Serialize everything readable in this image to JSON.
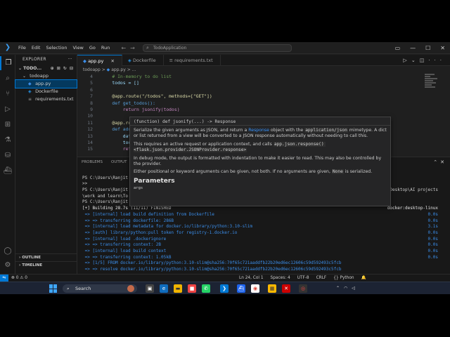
{
  "titlebar": {
    "menu": [
      "File",
      "Edit",
      "Selection",
      "View",
      "Go",
      "Run"
    ],
    "search": "TodoApplication"
  },
  "sidebar": {
    "header": "EXPLORER",
    "root": "TODO...",
    "folder": "todoapp",
    "files": [
      {
        "name": "app.py",
        "icon": "py"
      },
      {
        "name": "Dockerfile",
        "icon": "docker"
      },
      {
        "name": "requirements.txt",
        "icon": "txt"
      }
    ],
    "outline": "OUTLINE",
    "timeline": "TIMELINE"
  },
  "tabs": [
    {
      "label": "app.py",
      "active": true
    },
    {
      "label": "Dockerfile",
      "active": false
    },
    {
      "label": "requirements.txt",
      "active": false
    }
  ],
  "breadcrumb": {
    "folder": "todoapp",
    "sep": ">",
    "file": "app.py",
    "more": "> ..."
  },
  "code": [
    {
      "n": "4",
      "t": "    # In-memory to do list"
    },
    {
      "n": "5",
      "t": "    todos = []"
    },
    {
      "n": "6",
      "t": ""
    },
    {
      "n": "7",
      "t": "    @app.route(\"/todos\", methods=[\"GET\"])"
    },
    {
      "n": "8",
      "t": "    def get_todos():"
    },
    {
      "n": "9",
      "t": "        return jsonify(todos)"
    },
    {
      "n": "10",
      "t": ""
    },
    {
      "n": "11",
      "t": "    @app.route("
    },
    {
      "n": "12",
      "t": "    def add_todo"
    },
    {
      "n": "13",
      "t": "        data ="
    },
    {
      "n": "14",
      "t": "        todos.a"
    },
    {
      "n": "15",
      "t": "        return"
    }
  ],
  "hover": {
    "signature": "(function) def jsonify(...) -> Response",
    "p1_a": "Serialize the given arguments as JSON, and return a ",
    "p1_link": "Response",
    "p1_b": " object with the ",
    "p1_mono": "application/json",
    "p1_c": " mimetype. A dict or list returned from a view will be converted to a JSON response automatically without needing to call this.",
    "p2_a": "This requires an active request or application context, and calls ",
    "p2_mono": "app.json.response()",
    "p2_b": " <flask.json.provider.JSONProvider.response>",
    "p3": "In debug mode, the output is formatted with indentation to make it easier to read. This may also be controlled by the provider.",
    "p4_a": "Either positional or keyword arguments can be given, not both. If no arguments are given, ",
    "p4_mono": "None",
    "p4_b": " is serialized.",
    "heading": "Parameters",
    "arg": "args"
  },
  "panel": {
    "tabs": [
      "PROBLEMS",
      "OUTPUT"
    ],
    "terminal": [
      {
        "t": "",
        "r": ""
      },
      {
        "t": "PS C:\\Users\\Ranjit",
        "r": ""
      },
      {
        "t": ">>",
        "r": ""
      },
      {
        "t": "PS C:\\Users\\Ranjit",
        "r": ".Desktop\\AI projects"
      },
      {
        "t": "\\work and learn\\To",
        "r": ""
      },
      {
        "t": "PS C:\\Users\\Ranjit",
        "r": ""
      },
      {
        "t": "[+] Building 28.7s (11/11) FINISHED",
        "r": "docker:desktop-linux"
      },
      {
        "t": " => [internal] load build definition from Dockerfile",
        "r": "0.0s"
      },
      {
        "t": " => => transferring dockerfile: 286B",
        "r": "0.0s"
      },
      {
        "t": " => [internal] load metadata for docker.io/library/python:3.10-slim",
        "r": "3.1s"
      },
      {
        "t": " => [auth] library/python:pull token for registry-1.docker.io",
        "r": "0.0s"
      },
      {
        "t": " => [internal] load .dockerignore",
        "r": "0.0s"
      },
      {
        "t": " => => transferring context: 2B",
        "r": "0.0s"
      },
      {
        "t": " => [internal] load build context",
        "r": "0.0s"
      },
      {
        "t": " => => transferring context: 1.05kB",
        "r": "0.0s"
      },
      {
        "t": " => [1/5] FROM docker.io/library/python:3.10-slim@sha256:70f65c721aaddfb22b20ed6ec12606c59d592493c5fcb",
        "r": ""
      },
      {
        "t": " => => resolve docker.io/library/python:3.10-slim@sha256:70f65c721aaddfb22b20ed6ec12606c59d592493c5fcb",
        "r": ""
      }
    ]
  },
  "status": {
    "left": "⊗ 0 ⚠ 0",
    "items": [
      "Ln 24, Col 1",
      "Spaces: 4",
      "UTF-8",
      "CRLF",
      "{} Python"
    ]
  },
  "taskbar": {
    "search": "Search"
  },
  "colors": {
    "accent": "#0078d4",
    "editor_bg": "#1f1f1f",
    "sidebar_bg": "#181818"
  }
}
